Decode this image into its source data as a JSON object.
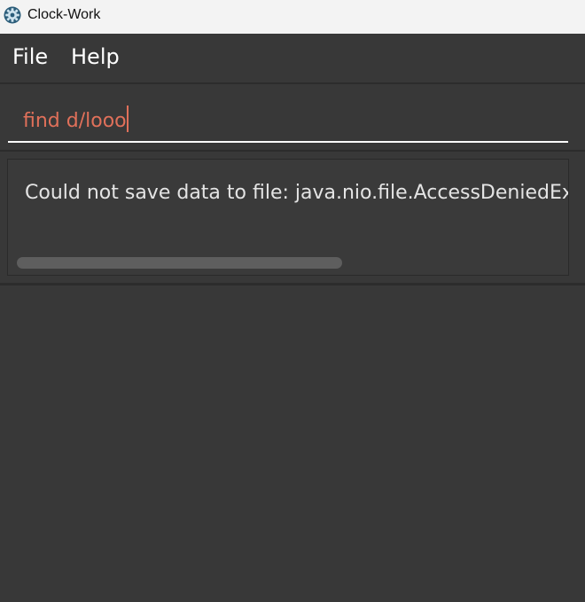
{
  "window": {
    "title": "Clock-Work",
    "icon": "gear-icon"
  },
  "menu": {
    "file_label": "File",
    "help_label": "Help"
  },
  "command": {
    "value": "find d/looo"
  },
  "result": {
    "text": "Could not save data to file: java.nio.file.AccessDeniedException"
  },
  "colors": {
    "background": "#383838",
    "command_text": "#e0705a",
    "result_text": "#e4e4e4",
    "titlebar": "#f3f3f3"
  }
}
